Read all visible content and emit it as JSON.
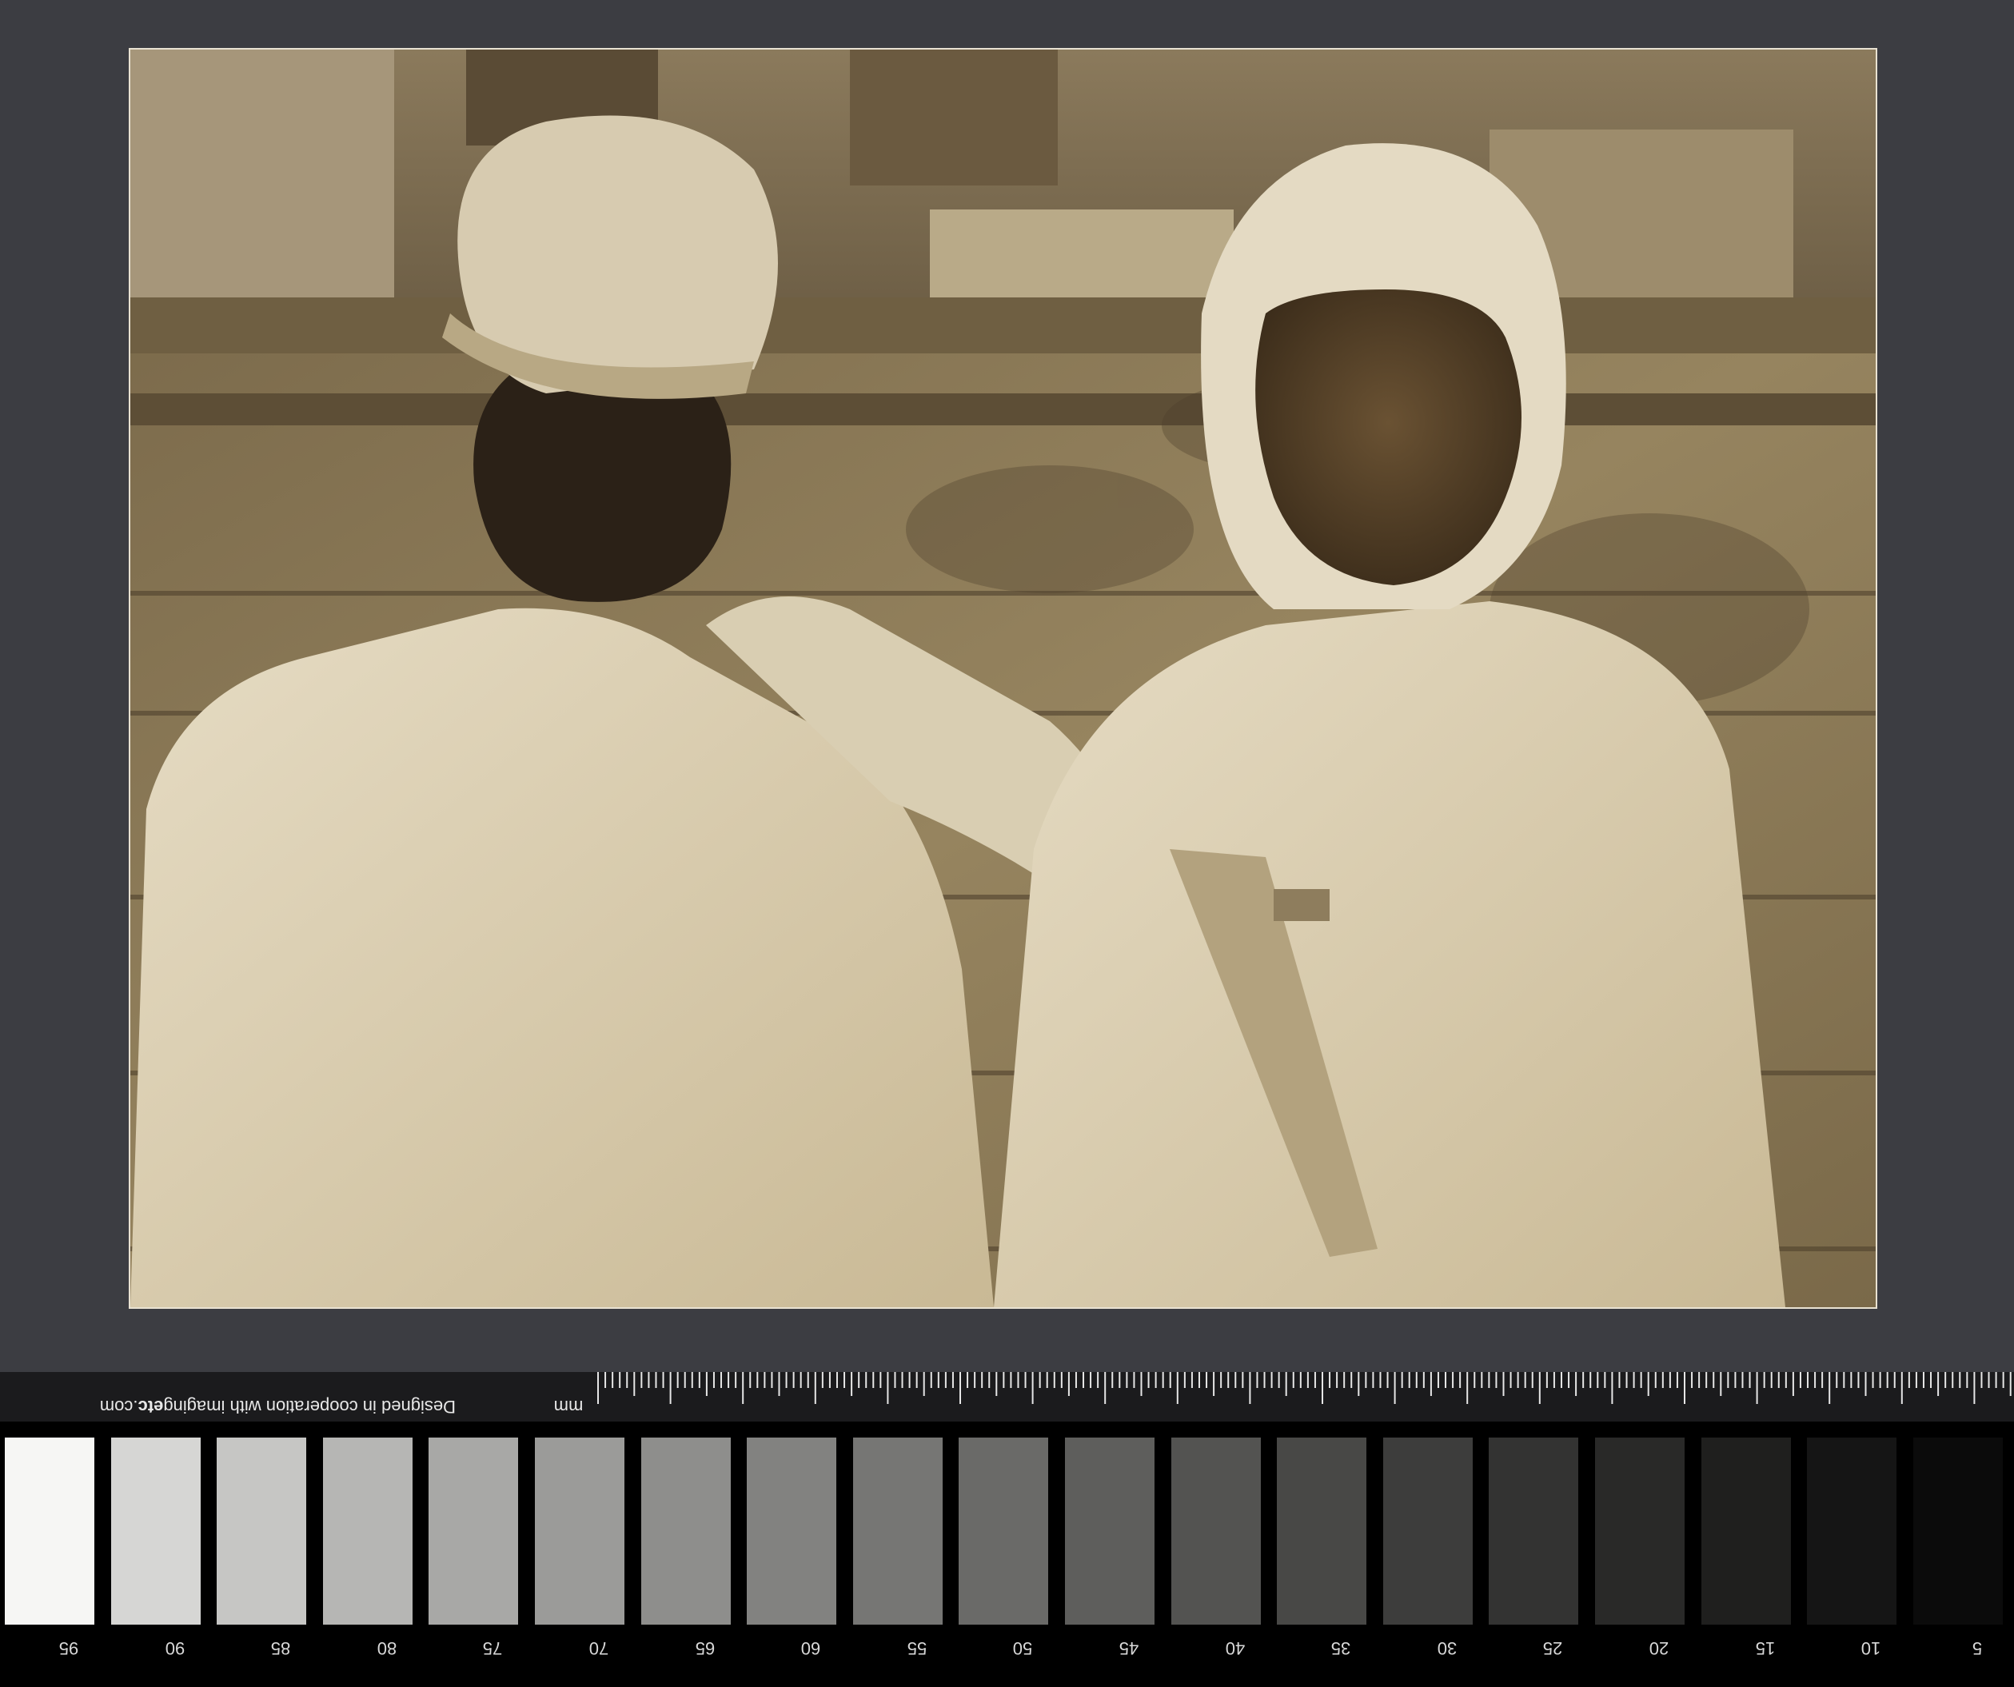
{
  "card": {
    "credit_prefix": "Designed in cooperation with imaging",
    "credit_brand": "etc",
    "credit_suffix": ".com",
    "unit": "mm"
  },
  "scale": {
    "labels": [
      "95",
      "90",
      "85",
      "80",
      "75",
      "70",
      "65",
      "60",
      "55",
      "50",
      "45",
      "40",
      "35",
      "30",
      "25",
      "20",
      "15",
      "10",
      "5"
    ]
  },
  "colors": {
    "background": "#3c3d42",
    "photo_tone": "sepia",
    "patches": [
      "#f6f6f4",
      "#d6d6d4",
      "#c6c6c4",
      "#b6b6b4",
      "#a8a8a6",
      "#9b9b99",
      "#8e8e8c",
      "#828280",
      "#767674",
      "#6a6a68",
      "#5e5e5c",
      "#535351",
      "#484846",
      "#3d3d3c",
      "#333332",
      "#292928",
      "#1f1f1e",
      "#151515",
      "#0b0b0b"
    ]
  }
}
